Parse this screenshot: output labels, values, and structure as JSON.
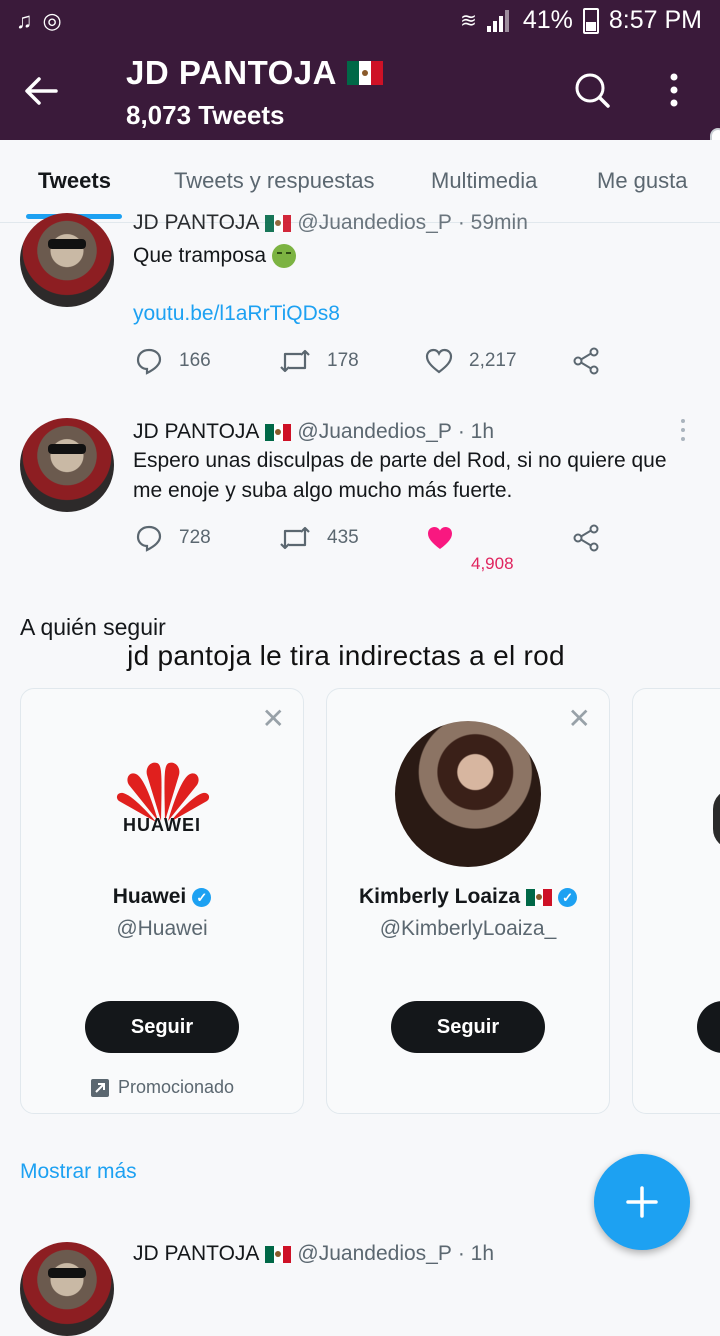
{
  "status_bar": {
    "battery": "41%",
    "time": "8:57 PM"
  },
  "profile": {
    "name": "JD PANTOJA",
    "tweet_count": "8,073 Tweets"
  },
  "tabs": [
    {
      "label": "Tweets",
      "active": true
    },
    {
      "label": "Tweets y respuestas",
      "active": false
    },
    {
      "label": "Multimedia",
      "active": false
    },
    {
      "label": "Me gusta",
      "active": false
    }
  ],
  "tweets": [
    {
      "author": "JD PANTOJA",
      "handle": "@Juandedios_P",
      "time": "· 59min",
      "text": "Que tramposa",
      "link": "youtu.be/l1aRrTiQDs8",
      "replies": "166",
      "retweets": "178",
      "likes": "2,217",
      "liked": false
    },
    {
      "author": "JD PANTOJA",
      "handle": "@Juandedios_P",
      "time": "· 1h",
      "text": "Espero unas disculpas de parte del Rod, si no quiere que me enoje y suba algo mucho más fuerte.",
      "replies": "728",
      "retweets": "435",
      "likes": "4,908",
      "liked": true
    },
    {
      "author": "JD PANTOJA",
      "handle": "@Juandedios_P",
      "time": "· 1h"
    }
  ],
  "who_to_follow": {
    "title": "A quién seguir",
    "caption": "jd pantoja le tira indirectas a el rod",
    "cards": [
      {
        "logo_text": "HUAWEI",
        "name": "Huawei",
        "username": "@Huawei",
        "button": "Seguir",
        "promoted": "Promocionado"
      },
      {
        "name": "Kimberly Loaiza",
        "username": "@KimberlyLoaiza_",
        "button": "Seguir"
      }
    ],
    "show_more": "Mostrar más"
  },
  "colors": {
    "header": "#3a1a3a",
    "accent": "#1da1f2",
    "like": "#e0245e"
  },
  "icons": [
    "back-arrow-icon",
    "search-icon",
    "more-vertical-icon",
    "reply-icon",
    "retweet-icon",
    "heart-icon",
    "share-icon",
    "close-icon",
    "verified-icon",
    "compose-icon"
  ]
}
